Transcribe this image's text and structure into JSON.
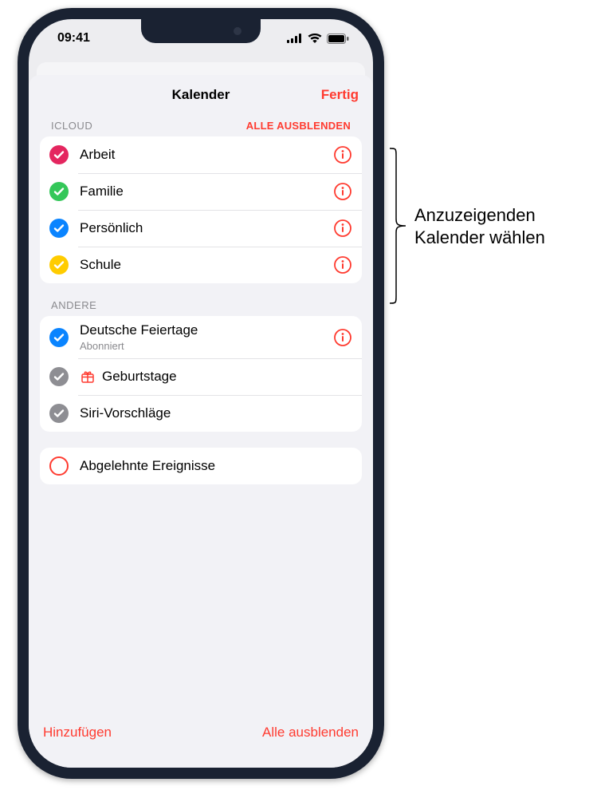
{
  "statusbar": {
    "time": "09:41"
  },
  "sheet": {
    "title": "Kalender",
    "done_label": "Fertig"
  },
  "sections": {
    "icloud": {
      "header": "ICLOUD",
      "hide_all": "ALLE AUSBLENDEN",
      "items": [
        {
          "label": "Arbeit",
          "color": "#e4265f",
          "checked": true
        },
        {
          "label": "Familie",
          "color": "#34c759",
          "checked": true
        },
        {
          "label": "Persönlich",
          "color": "#0a84ff",
          "checked": true
        },
        {
          "label": "Schule",
          "color": "#ffcc00",
          "checked": true
        }
      ]
    },
    "andere": {
      "header": "ANDERE",
      "items": [
        {
          "label": "Deutsche Feiertage",
          "sub": "Abonniert",
          "color": "#0a84ff",
          "checked": true,
          "info": true
        },
        {
          "label": "Geburtstage",
          "gift": true,
          "color": "#8e8e93",
          "checked": true,
          "info": false
        },
        {
          "label": "Siri-Vorschläge",
          "color": "#8e8e93",
          "checked": true,
          "info": false
        }
      ]
    },
    "declined": {
      "label": "Abgelehnte Ereignisse",
      "checked": false
    }
  },
  "footer": {
    "add_label": "Hinzufügen",
    "hide_all_label": "Alle ausblenden"
  },
  "callout": {
    "line1": "Anzuzeigenden",
    "line2": "Kalender wählen"
  },
  "colors": {
    "accent": "#ff3b30"
  }
}
